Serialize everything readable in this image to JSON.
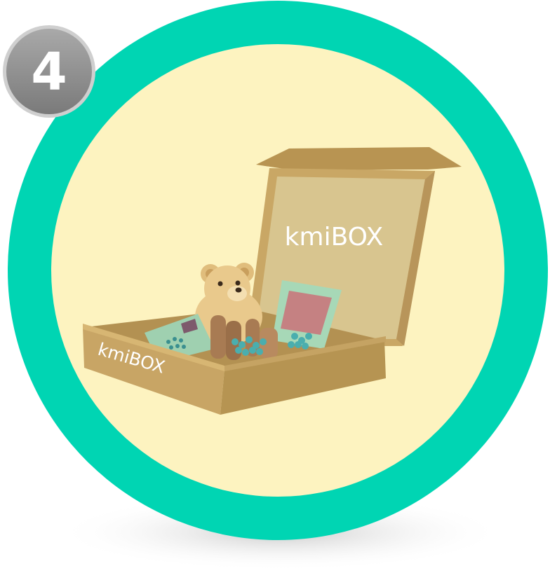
{
  "step": {
    "number": "4"
  },
  "box": {
    "brand_lid": "kmiBOX",
    "brand_front": "kmiBOX"
  },
  "colors": {
    "ring": "#00d5b3",
    "disc": "#fdf3c0",
    "badge": "#8e8e8e",
    "box_outer": "#c8a565",
    "box_inner": "#d8c58f",
    "bear": "#e9c98c"
  },
  "icons": {
    "badge": "step-number-badge",
    "box": "subscription-box-illustration",
    "toy": "teddy-bear-icon",
    "treats": "dog-bone-treats-icon"
  }
}
